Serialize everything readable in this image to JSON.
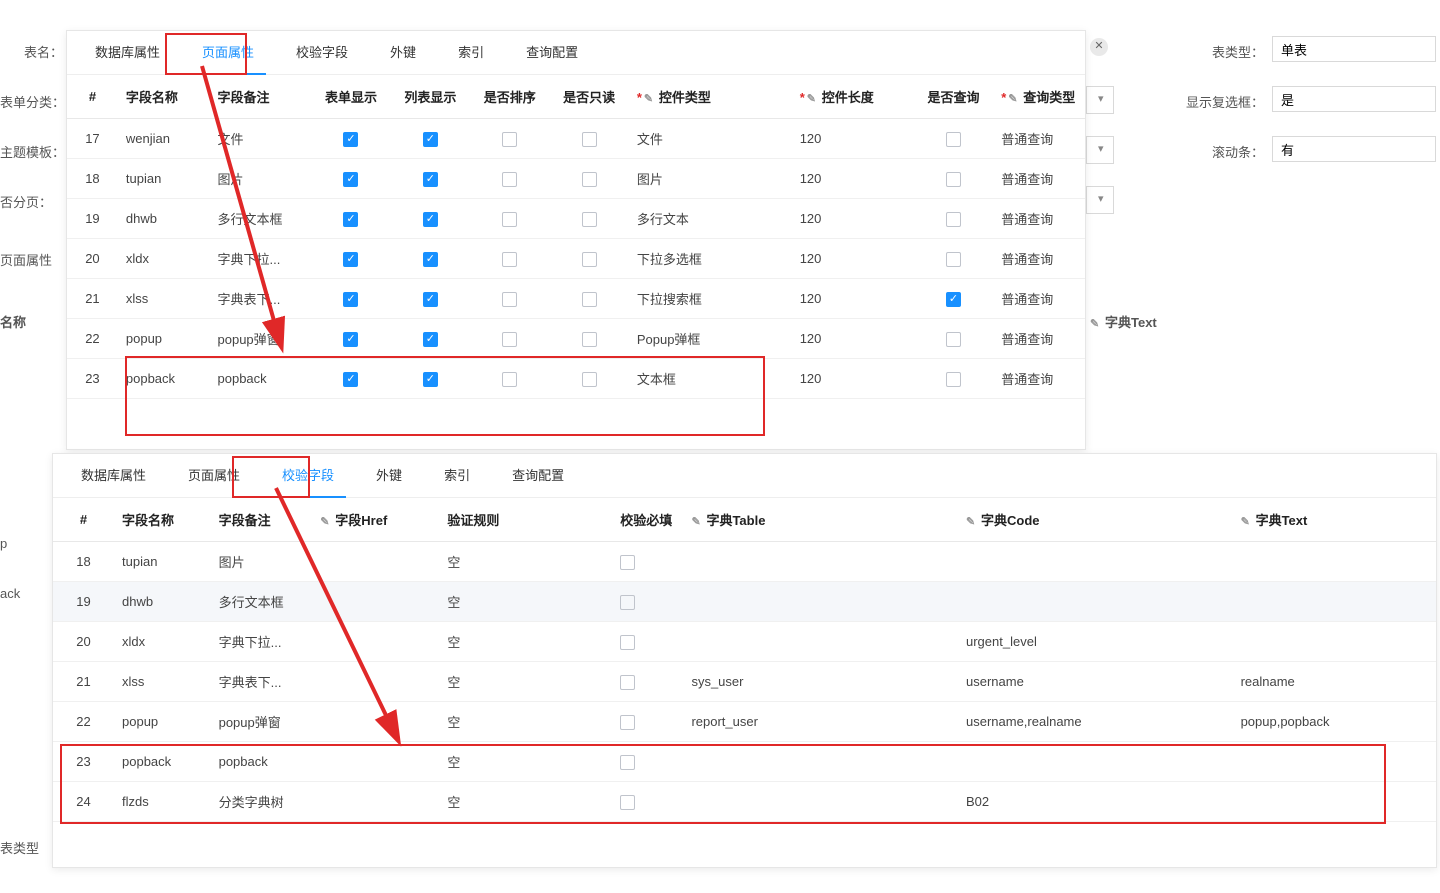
{
  "bg": {
    "table_name_label": "表名：",
    "table_type_label": "表类型：",
    "table_type_value": "单表",
    "form_cat_label": "表单分类：",
    "show_chk_label": "显示复选框：",
    "show_chk_value": "是",
    "theme_label": "主题模板：",
    "scroll_label": "滚动条：",
    "scroll_value": "有",
    "paging_label": "否分页：",
    "page_attr_label": "页面属性",
    "name_col": "名称",
    "dict_text": "字典Text",
    "popup_cut": "p",
    "popback_cut": "ack",
    "flzds_cut": "表类型"
  },
  "tabs": [
    "数据库属性",
    "页面属性",
    "校验字段",
    "外键",
    "索引",
    "查询配置"
  ],
  "panel1": {
    "headers": {
      "idx": "#",
      "name": "字段名称",
      "remark": "字段备注",
      "form_show": "表单显示",
      "list_show": "列表显示",
      "sortable": "是否排序",
      "readonly": "是否只读",
      "ctrl_type": "控件类型",
      "ctrl_len": "控件长度",
      "is_query": "是否查询",
      "query_type": "查询类型"
    },
    "rows": [
      {
        "idx": 17,
        "name": "wenjian",
        "remark": "文件",
        "ctrl": "文件",
        "len": "120",
        "q": false,
        "qt": "普通查询",
        "fs": true,
        "ls": true
      },
      {
        "idx": 18,
        "name": "tupian",
        "remark": "图片",
        "ctrl": "图片",
        "len": "120",
        "q": false,
        "qt": "普通查询",
        "fs": true,
        "ls": true
      },
      {
        "idx": 19,
        "name": "dhwb",
        "remark": "多行文本框",
        "ctrl": "多行文本",
        "len": "120",
        "q": false,
        "qt": "普通查询",
        "fs": true,
        "ls": true
      },
      {
        "idx": 20,
        "name": "xldx",
        "remark": "字典下拉...",
        "ctrl": "下拉多选框",
        "len": "120",
        "q": false,
        "qt": "普通查询",
        "fs": true,
        "ls": true
      },
      {
        "idx": 21,
        "name": "xlss",
        "remark": "字典表下...",
        "ctrl": "下拉搜索框",
        "len": "120",
        "q": true,
        "qt": "普通查询",
        "fs": true,
        "ls": true
      },
      {
        "idx": 22,
        "name": "popup",
        "remark": "popup弹窗",
        "ctrl": "Popup弹框",
        "len": "120",
        "q": false,
        "qt": "普通查询",
        "fs": true,
        "ls": true
      },
      {
        "idx": 23,
        "name": "popback",
        "remark": "popback",
        "ctrl": "文本框",
        "len": "120",
        "q": false,
        "qt": "普通查询",
        "fs": true,
        "ls": true
      }
    ]
  },
  "panel2": {
    "headers": {
      "idx": "#",
      "name": "字段名称",
      "remark": "字段备注",
      "href": "字段Href",
      "vrule": "验证规则",
      "required": "校验必填",
      "dtable": "字典Table",
      "dcode": "字典Code",
      "dtext": "字典Text"
    },
    "rows": [
      {
        "idx": 18,
        "name": "tupian",
        "remark": "图片",
        "vr": "空",
        "dt": "",
        "dc": "",
        "dx": ""
      },
      {
        "idx": 19,
        "name": "dhwb",
        "remark": "多行文本框",
        "vr": "空",
        "dt": "",
        "dc": "",
        "dx": "",
        "sel": true
      },
      {
        "idx": 20,
        "name": "xldx",
        "remark": "字典下拉...",
        "vr": "空",
        "dt": "",
        "dc": "urgent_level",
        "dx": ""
      },
      {
        "idx": 21,
        "name": "xlss",
        "remark": "字典表下...",
        "vr": "空",
        "dt": "sys_user",
        "dc": "username",
        "dx": "realname"
      },
      {
        "idx": 22,
        "name": "popup",
        "remark": "popup弹窗",
        "vr": "空",
        "dt": "report_user",
        "dc": "username,realname",
        "dx": "popup,popback"
      },
      {
        "idx": 23,
        "name": "popback",
        "remark": "popback",
        "vr": "空",
        "dt": "",
        "dc": "",
        "dx": ""
      },
      {
        "idx": 24,
        "name": "flzds",
        "remark": "分类字典树",
        "vr": "空",
        "dt": "",
        "dc": "B02",
        "dx": ""
      }
    ]
  }
}
